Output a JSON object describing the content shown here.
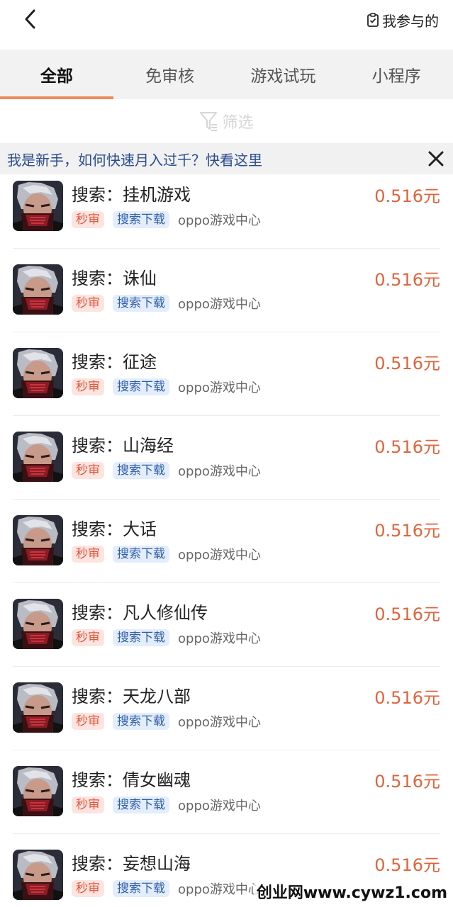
{
  "header": {
    "back_icon": "chevron-left-icon",
    "mine_icon": "clipboard-check-icon",
    "mine_label": "我参与的"
  },
  "tabs": [
    {
      "label": "全部",
      "active": true
    },
    {
      "label": "免审核",
      "active": false
    },
    {
      "label": "游戏试玩",
      "active": false
    },
    {
      "label": "小程序",
      "active": false
    }
  ],
  "filter": {
    "icon": "filter-icon",
    "label": "筛选"
  },
  "notice": {
    "text": "我是新手，如何快速月入过千？快看这里",
    "close_icon": "close-icon"
  },
  "tasks": [
    {
      "title": "搜索：挂机游戏",
      "price": "0.516元",
      "tag1": "秒审",
      "tag2": "搜索下载",
      "source": "oppo游戏中心"
    },
    {
      "title": "搜索：诛仙",
      "price": "0.516元",
      "tag1": "秒审",
      "tag2": "搜索下载",
      "source": "oppo游戏中心"
    },
    {
      "title": "搜索：征途",
      "price": "0.516元",
      "tag1": "秒审",
      "tag2": "搜索下载",
      "source": "oppo游戏中心"
    },
    {
      "title": "搜索：山海经",
      "price": "0.516元",
      "tag1": "秒审",
      "tag2": "搜索下载",
      "source": "oppo游戏中心"
    },
    {
      "title": "搜索：大话",
      "price": "0.516元",
      "tag1": "秒审",
      "tag2": "搜索下载",
      "source": "oppo游戏中心"
    },
    {
      "title": "搜索：凡人修仙传",
      "price": "0.516元",
      "tag1": "秒审",
      "tag2": "搜索下载",
      "source": "oppo游戏中心"
    },
    {
      "title": "搜索：天龙八部",
      "price": "0.516元",
      "tag1": "秒审",
      "tag2": "搜索下载",
      "source": "oppo游戏中心"
    },
    {
      "title": "搜索：倩女幽魂",
      "price": "0.516元",
      "tag1": "秒审",
      "tag2": "搜索下载",
      "source": "oppo游戏中心"
    },
    {
      "title": "搜索：妄想山海",
      "price": "0.516元",
      "tag1": "秒审",
      "tag2": "搜索下载",
      "source": "oppo游戏中心"
    }
  ],
  "watermark": "创业网www.cywz1.com",
  "colors": {
    "accent": "#ef8a5e",
    "price": "#e0643c",
    "notice": "#2b4c8f"
  }
}
